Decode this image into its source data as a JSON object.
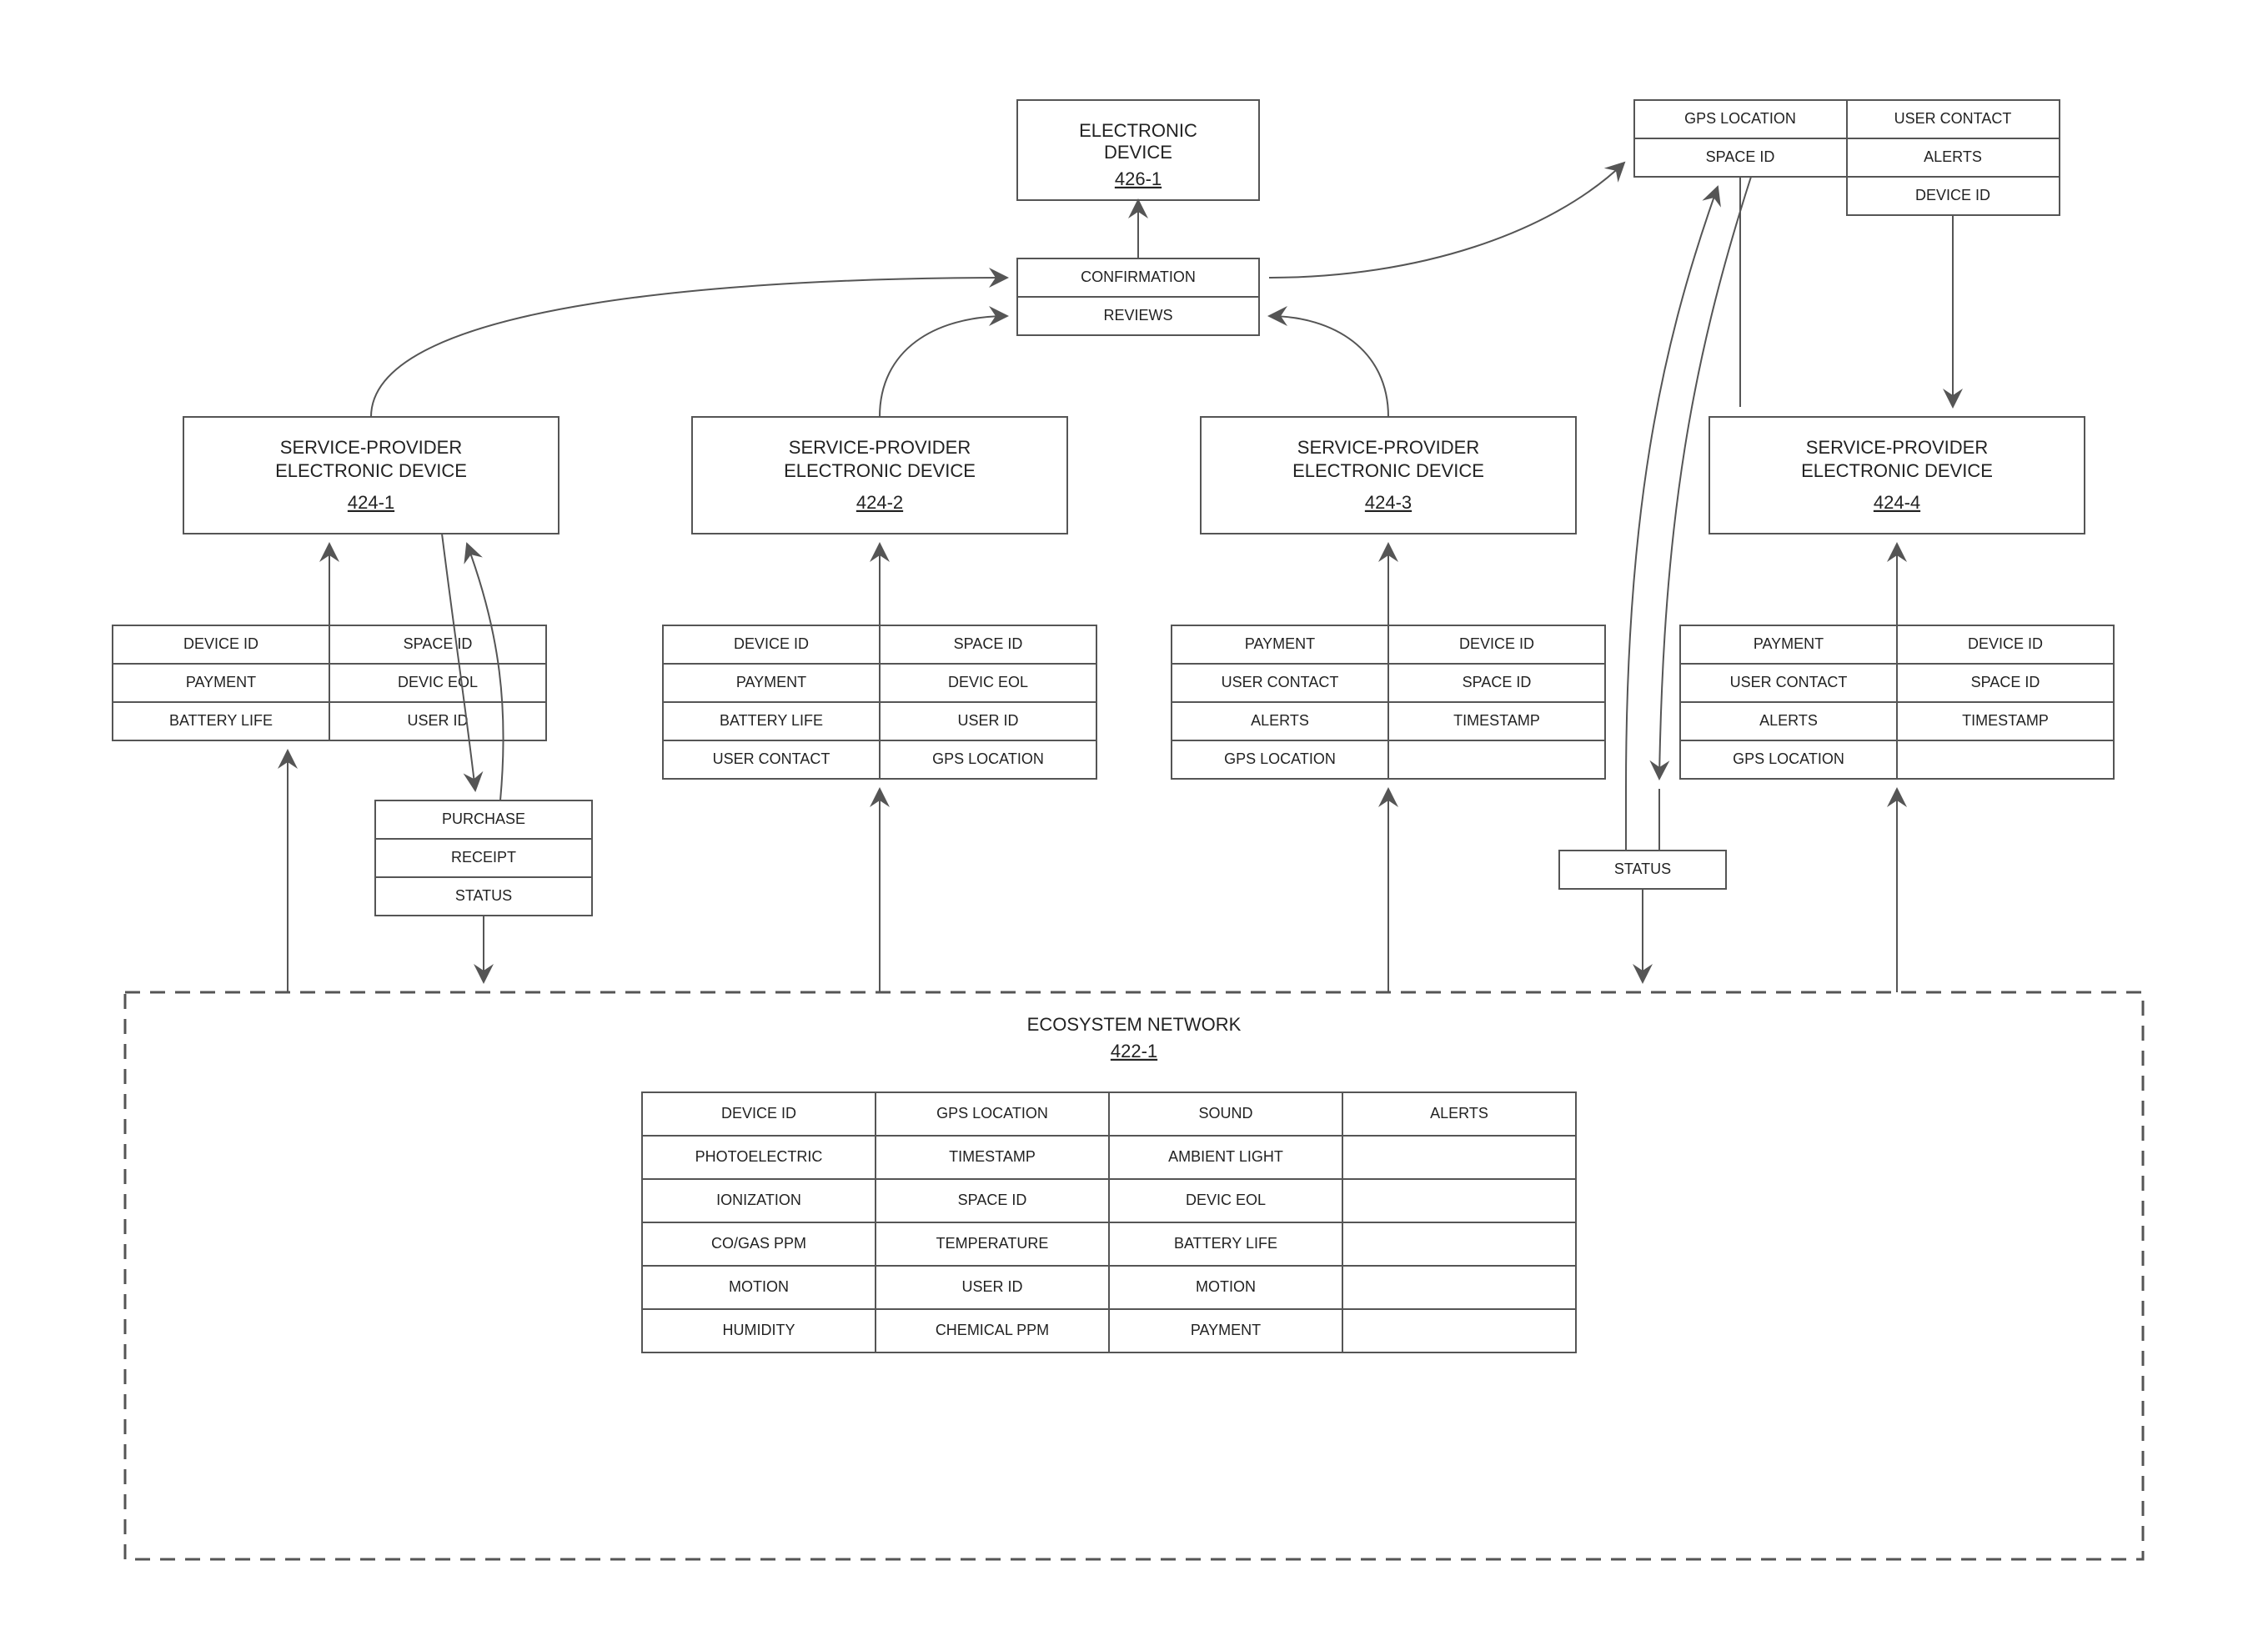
{
  "electronicDevice": {
    "title": "ELECTRONIC DEVICE",
    "ref": "426-1"
  },
  "confirmation": "CONFIRMATION",
  "reviews": "REVIEWS",
  "topRight": {
    "r1c1": "GPS LOCATION",
    "r1c2": "USER CONTACT",
    "r2c1": "SPACE ID",
    "r2c2": "ALERTS",
    "r3c2": "DEVICE ID"
  },
  "providers": {
    "p1": {
      "title": "SERVICE-PROVIDER ELECTRONIC DEVICE",
      "ref": "424-1"
    },
    "p2": {
      "title": "SERVICE-PROVIDER ELECTRONIC DEVICE",
      "ref": "424-2"
    },
    "p3": {
      "title": "SERVICE-PROVIDER ELECTRONIC DEVICE",
      "ref": "424-3"
    },
    "p4": {
      "title": "SERVICE-PROVIDER ELECTRONIC DEVICE",
      "ref": "424-4"
    }
  },
  "grid1": {
    "r1c1": "DEVICE ID",
    "r1c2": "SPACE ID",
    "r2c1": "PAYMENT",
    "r2c2": "DEVIC EOL",
    "r3c1": "BATTERY LIFE",
    "r3c2": "USER ID"
  },
  "grid2": {
    "r1c1": "DEVICE ID",
    "r1c2": "SPACE ID",
    "r2c1": "PAYMENT",
    "r2c2": "DEVIC EOL",
    "r3c1": "BATTERY LIFE",
    "r3c2": "USER ID",
    "r4c1": "USER CONTACT",
    "r4c2": "GPS LOCATION"
  },
  "grid3": {
    "r1c1": "PAYMENT",
    "r1c2": "DEVICE ID",
    "r2c1": "USER CONTACT",
    "r2c2": "SPACE ID",
    "r3c1": "ALERTS",
    "r3c2": "TIMESTAMP",
    "r4c1": "GPS LOCATION",
    "r4c2": ""
  },
  "grid4": {
    "r1c1": "PAYMENT",
    "r1c2": "DEVICE ID",
    "r2c1": "USER CONTACT",
    "r2c2": "SPACE ID",
    "r3c1": "ALERTS",
    "r3c2": "TIMESTAMP",
    "r4c1": "GPS LOCATION",
    "r4c2": ""
  },
  "stack1": {
    "r1": "PURCHASE",
    "r2": "RECEIPT",
    "r3": "STATUS"
  },
  "status": "STATUS",
  "ecosystem": {
    "title": "ECOSYSTEM NETWORK",
    "ref": "422-1"
  },
  "ecoGrid": {
    "r1c1": "DEVICE ID",
    "r1c2": "GPS LOCATION",
    "r1c3": "SOUND",
    "r1c4": "ALERTS",
    "r2c1": "PHOTOELECTRIC",
    "r2c2": "TIMESTAMP",
    "r2c3": "AMBIENT LIGHT",
    "r2c4": "",
    "r3c1": "IONIZATION",
    "r3c2": "SPACE ID",
    "r3c3": "DEVIC EOL",
    "r3c4": "",
    "r4c1": "CO/GAS PPM",
    "r4c2": "TEMPERATURE",
    "r4c3": "BATTERY LIFE",
    "r4c4": "",
    "r5c1": "MOTION",
    "r5c2": "USER ID",
    "r5c3": "MOTION",
    "r5c4": "",
    "r6c1": "HUMIDITY",
    "r6c2": "CHEMICAL PPM",
    "r6c3": "PAYMENT",
    "r6c4": ""
  }
}
